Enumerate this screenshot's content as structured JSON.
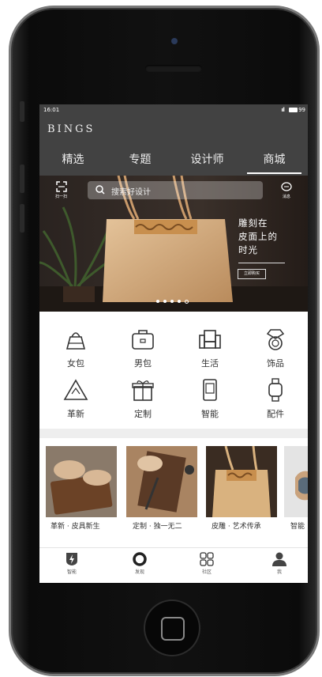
{
  "status_bar": {
    "time": "16:01",
    "battery": "99"
  },
  "brand": "BINGS",
  "tabs": [
    "精选",
    "专题",
    "设计师",
    "商城"
  ],
  "active_tab": "商城",
  "banner": {
    "scan_label": "扫一扫",
    "search_placeholder": "搜索好设计",
    "message_label": "消息",
    "tagline_lines": [
      "雕刻在",
      "皮面上的",
      "时光"
    ],
    "buy_label": "立即购买",
    "slide_count": 5,
    "active_slide": 5
  },
  "categories": [
    {
      "label": "女包",
      "icon": "handbag-icon"
    },
    {
      "label": "男包",
      "icon": "briefcase-icon"
    },
    {
      "label": "生活",
      "icon": "sofa-icon"
    },
    {
      "label": "饰品",
      "icon": "ring-icon"
    },
    {
      "label": "革新",
      "icon": "recycle-icon"
    },
    {
      "label": "定制",
      "icon": "gift-icon"
    },
    {
      "label": "智能",
      "icon": "device-icon"
    },
    {
      "label": "配件",
      "icon": "watch-icon"
    }
  ],
  "features": [
    {
      "caption": "革新 · 皮具新生"
    },
    {
      "caption": "定制 · 独一无二"
    },
    {
      "caption": "皮雕 · 艺术传承"
    },
    {
      "caption": "智能"
    }
  ],
  "bottom_nav": [
    {
      "label": "智能",
      "icon": "bolt-shield-icon"
    },
    {
      "label": "发现",
      "icon": "ring-icon"
    },
    {
      "label": "社区",
      "icon": "grid-icon"
    },
    {
      "label": "我",
      "icon": "person-icon"
    }
  ],
  "colors": {
    "header": "#424242",
    "accent": "#ffffff",
    "banner_bg": "#2f2722"
  }
}
